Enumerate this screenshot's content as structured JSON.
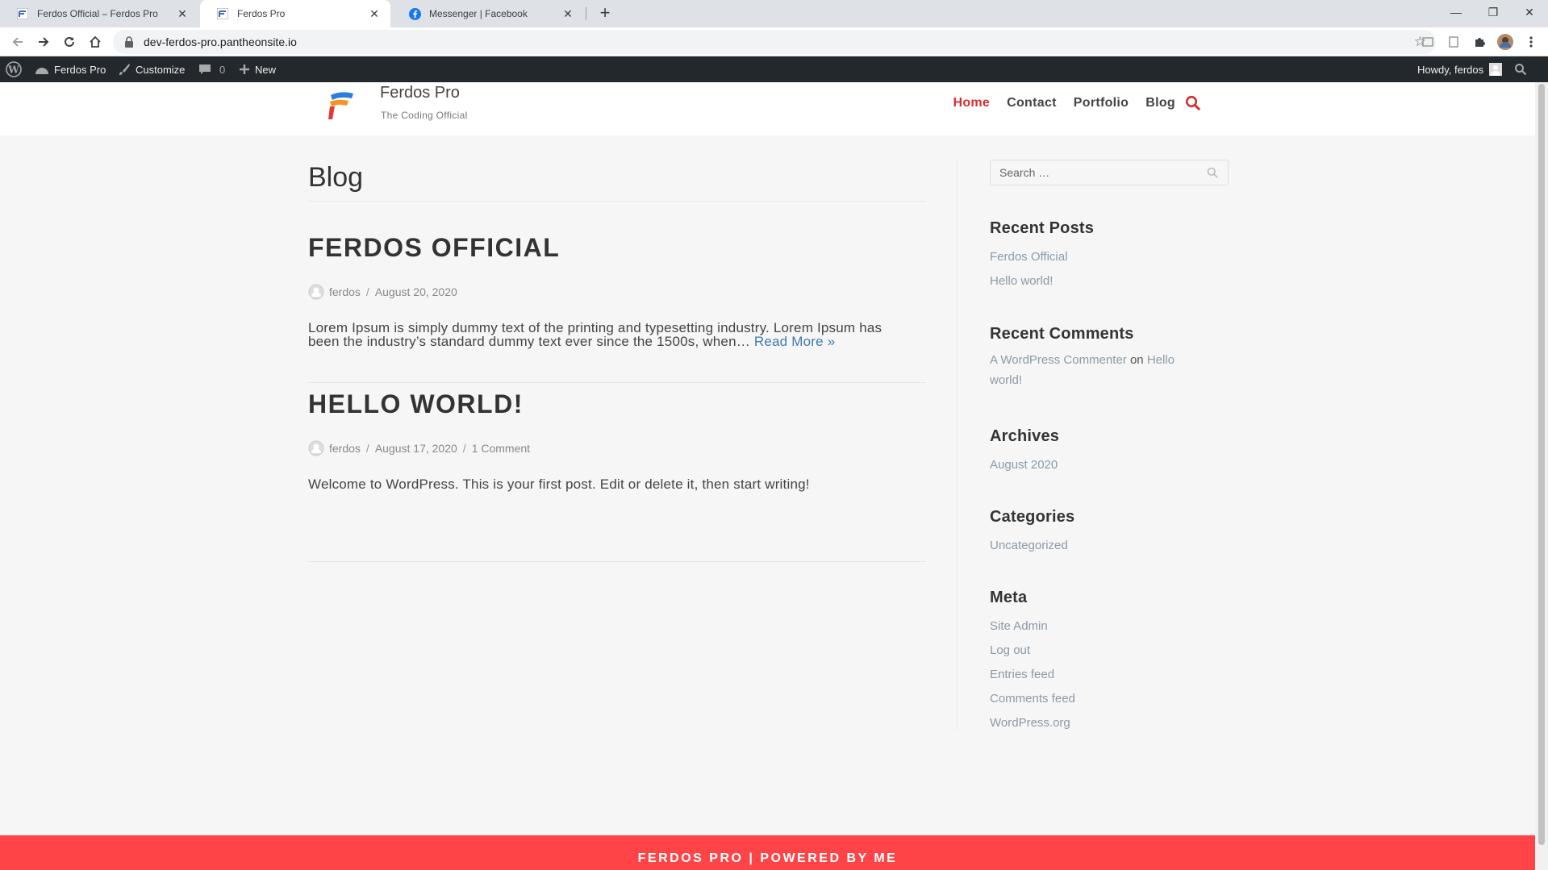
{
  "browser": {
    "tabs": [
      {
        "title": "Ferdos Official – Ferdos Pro",
        "icon": "ferdos-favicon"
      },
      {
        "title": "Ferdos Pro",
        "icon": "ferdos-favicon"
      },
      {
        "title": "Messenger | Facebook",
        "icon": "facebook-icon"
      }
    ],
    "new_tab": "+",
    "url": "dev-ferdos-pro.pantheonsite.io"
  },
  "adminbar": {
    "site_name": "Ferdos Pro",
    "customize": "Customize",
    "comments_count": "0",
    "new_label": "New",
    "howdy": "Howdy, ferdos"
  },
  "site": {
    "title": "Ferdos Pro",
    "tagline": "The Coding Official",
    "nav": [
      "Home",
      "Contact",
      "Portfolio",
      "Blog"
    ],
    "accent_color": "#d32f2f"
  },
  "page": {
    "title": "Blog"
  },
  "posts": [
    {
      "title": "FERDOS OFFICIAL",
      "author": "ferdos",
      "date": "August 20, 2020",
      "comments": "",
      "excerpt_line1": "Lorem Ipsum is simply dummy text of the printing and typesetting industry. Lorem Ipsum has",
      "excerpt_line2": "been the industry’s standard dummy text ever since the 1500s, when…",
      "read_more": "Read More »"
    },
    {
      "title": "HELLO WORLD!",
      "author": "ferdos",
      "date": "August 17, 2020",
      "comments": "1 Comment",
      "excerpt": "Welcome to WordPress. This is your first post. Edit or delete it, then start writing!"
    }
  ],
  "sidebar": {
    "search_placeholder": "Search …",
    "recent_posts": {
      "title": "Recent Posts",
      "items": [
        "Ferdos Official",
        "Hello world!"
      ]
    },
    "recent_comments": {
      "title": "Recent Comments",
      "author": "A WordPress Commenter",
      "on": "on",
      "post_part1": "Hello",
      "post_part2": "world!"
    },
    "archives": {
      "title": "Archives",
      "items": [
        "August 2020"
      ]
    },
    "categories": {
      "title": "Categories",
      "items": [
        "Uncategorized"
      ]
    },
    "meta": {
      "title": "Meta",
      "items": [
        "Site Admin",
        "Log out",
        "Entries feed",
        "Comments feed",
        "WordPress.org"
      ]
    }
  },
  "footer": {
    "text": "FERDOS PRO | POWERED BY ME",
    "color": "#ff4447"
  }
}
